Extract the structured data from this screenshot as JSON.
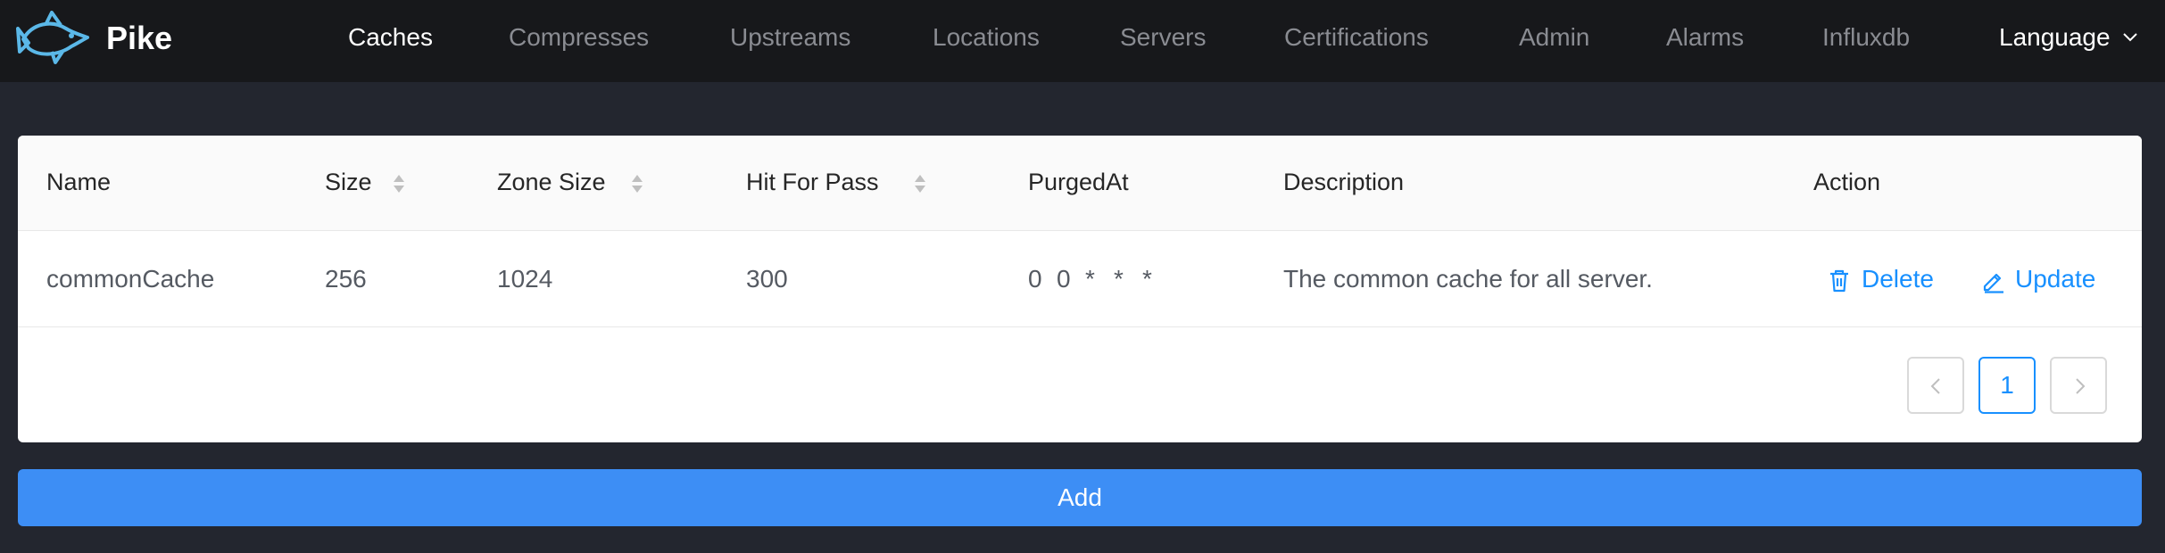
{
  "app": {
    "brand": "Pike"
  },
  "nav": {
    "items": [
      {
        "label": "Caches",
        "active": true
      },
      {
        "label": "Compresses"
      },
      {
        "label": "Upstreams"
      },
      {
        "label": "Locations"
      },
      {
        "label": "Servers"
      },
      {
        "label": "Certifications"
      },
      {
        "label": "Admin"
      },
      {
        "label": "Alarms"
      },
      {
        "label": "Influxdb"
      }
    ],
    "language": "Language"
  },
  "table": {
    "columns": [
      "Name",
      "Size",
      "Zone Size",
      "Hit For Pass",
      "PurgedAt",
      "Description",
      "Action"
    ],
    "rows": [
      {
        "name": "commonCache",
        "size": "256",
        "zone_size": "1024",
        "hit_for_pass": "300",
        "purged_at": [
          "0",
          "0",
          "*",
          "*",
          "*"
        ],
        "description": "The common cache for all server."
      }
    ],
    "actions": {
      "delete": "Delete",
      "update": "Update"
    }
  },
  "pagination": {
    "current": "1"
  },
  "add_button": "Add",
  "colors": {
    "accent": "#1890ff",
    "add_button": "#3d8ef5",
    "topbar": "#17181b",
    "page_bg": "#23262f"
  }
}
